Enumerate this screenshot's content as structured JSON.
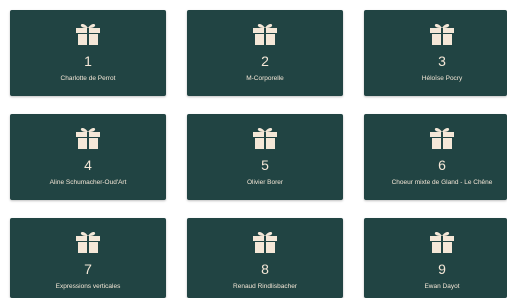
{
  "accent_color": "#214443",
  "text_color": "#f4e7d7",
  "icon": "gift-icon",
  "cards": [
    {
      "number": "1",
      "name": "Charlotte de Perrot"
    },
    {
      "number": "2",
      "name": "M-Corporelle"
    },
    {
      "number": "3",
      "name": "Héloïse Pocry"
    },
    {
      "number": "4",
      "name": "Aline Schumacher-Oud'Art"
    },
    {
      "number": "5",
      "name": "Olivier Borer"
    },
    {
      "number": "6",
      "name": "Choeur mixte de Gland - Le Chêne"
    },
    {
      "number": "7",
      "name": "Expressions verticales"
    },
    {
      "number": "8",
      "name": "Renaud Rindlisbacher"
    },
    {
      "number": "9",
      "name": "Ewan Dayot"
    }
  ]
}
